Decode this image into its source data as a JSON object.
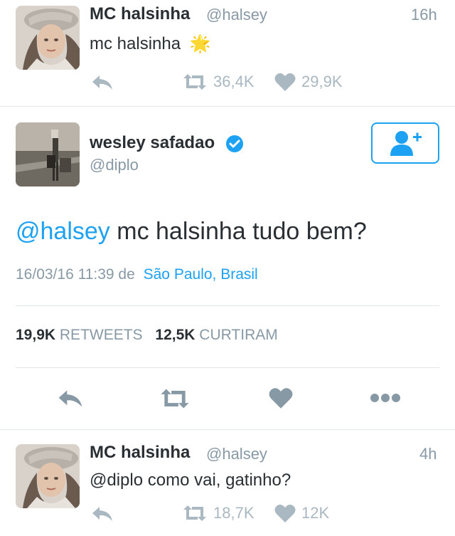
{
  "tweet1": {
    "name": "MC halsinha",
    "handle": "@halsey",
    "time": "16h",
    "text": "mc halsinha",
    "emoji": "🌟",
    "retweets": "36,4K",
    "likes": "29,9K"
  },
  "main": {
    "name": "wesley safadao",
    "handle": "@diplo",
    "verified": true,
    "mention": "@halsey",
    "text": " mc halsinha tudo bem?",
    "date": "16/03/16 11:39",
    "de": "de",
    "location": "São Paulo, Brasil",
    "retweets_count": "19,9K",
    "retweets_label": "RETWEETS",
    "likes_count": "12,5K",
    "likes_label": "CURTIRAM"
  },
  "tweet3": {
    "name": "MC halsinha",
    "handle": "@halsey",
    "time": "4h",
    "text": "@diplo como vai, gatinho?",
    "retweets": "18,7K",
    "likes": "12K"
  },
  "colors": {
    "accent": "#1da1f2",
    "icon_gray": "#aab8c2",
    "action_gray": "#8899a6"
  }
}
